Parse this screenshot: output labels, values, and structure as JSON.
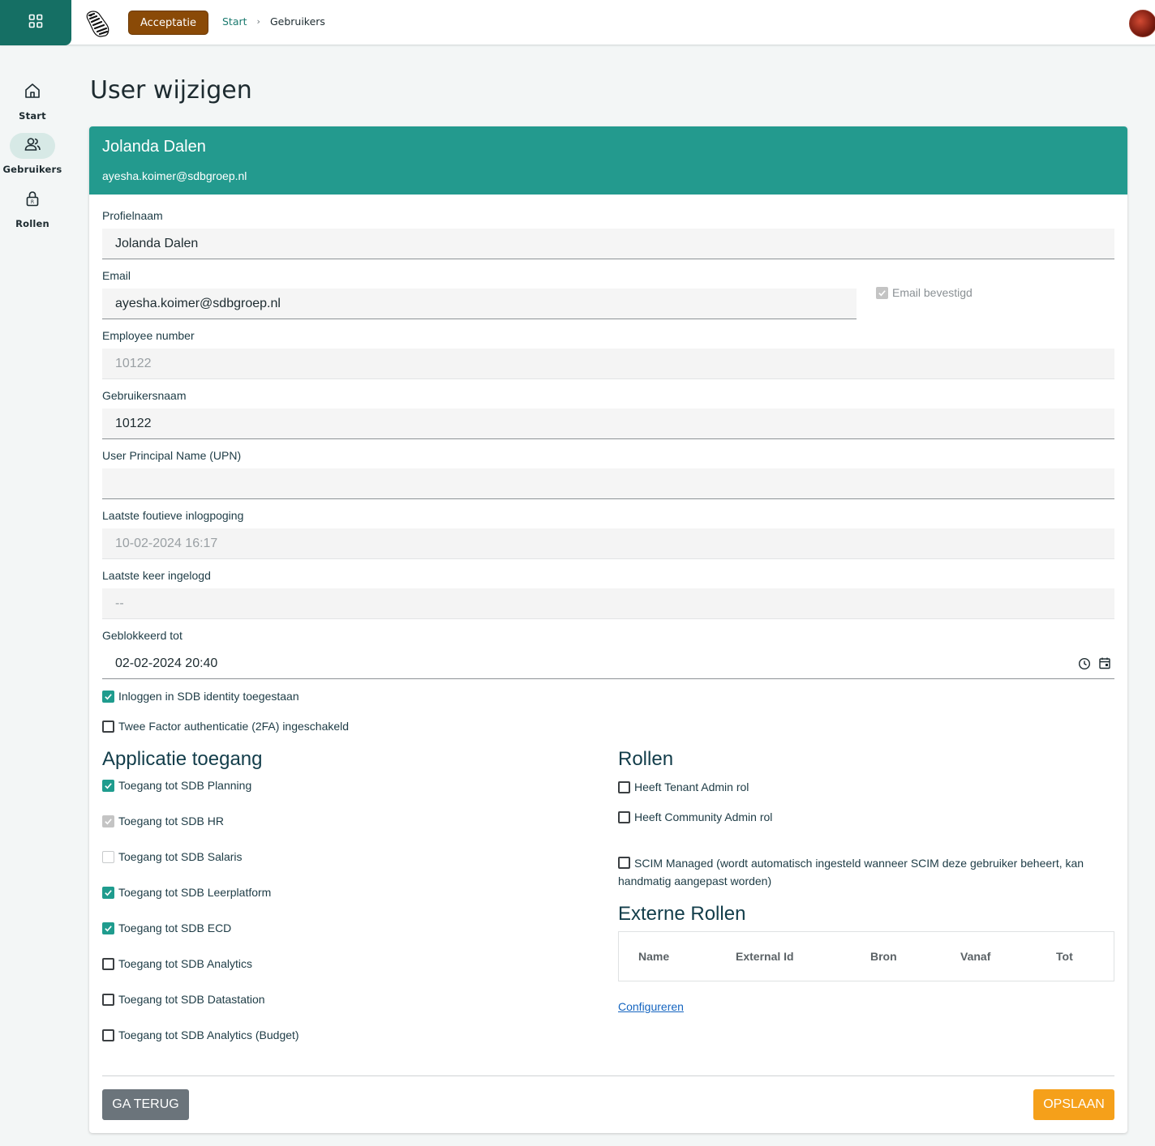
{
  "topbar": {
    "env_badge": "Acceptatie",
    "breadcrumb": {
      "start": "Start",
      "current": "Gebruikers"
    }
  },
  "sidenav": {
    "items": [
      {
        "label": "Start",
        "icon": "home-icon",
        "active": false
      },
      {
        "label": "Gebruikers",
        "icon": "users-icon",
        "active": true
      },
      {
        "label": "Rollen",
        "icon": "lock-icon",
        "active": false
      }
    ]
  },
  "page": {
    "title": "User wijzigen"
  },
  "card_header": {
    "name": "Jolanda Dalen",
    "email": "ayesha.koimer@sdbgroep.nl"
  },
  "form": {
    "profielnaam": {
      "label": "Profielnaam",
      "value": "Jolanda Dalen"
    },
    "email": {
      "label": "Email",
      "value": "ayesha.koimer@sdbgroep.nl",
      "confirmed_label": "Email bevestigd",
      "confirmed": true
    },
    "employee_number": {
      "label": "Employee number",
      "value": "10122"
    },
    "gebruikersnaam": {
      "label": "Gebruikersnaam",
      "value": "10122"
    },
    "upn": {
      "label": "User Principal Name (UPN)",
      "value": ""
    },
    "laatste_foutieve": {
      "label": "Laatste foutieve inlogpoging",
      "value": "10-02-2024 16:17"
    },
    "laatste_ingelogd": {
      "label": "Laatste keer ingelogd",
      "value": "--"
    },
    "geblokkeerd_tot": {
      "label": "Geblokkeerd tot",
      "value": "02-02-2024 20:40"
    },
    "inloggen": {
      "label": "Inloggen in SDB identity toegestaan",
      "checked": true
    },
    "twee_factor": {
      "label": "Twee Factor authenticatie (2FA) ingeschakeld",
      "checked": false
    }
  },
  "applicatie_toegang": {
    "title": "Applicatie toegang",
    "items": [
      {
        "label": "Toegang tot SDB Planning",
        "state": "checked"
      },
      {
        "label": "Toegang tot SDB HR",
        "state": "disabled-checked"
      },
      {
        "label": "Toegang tot SDB Salaris",
        "state": "disabled"
      },
      {
        "label": "Toegang tot SDB Leerplatform",
        "state": "checked"
      },
      {
        "label": "Toegang tot SDB ECD",
        "state": "checked"
      },
      {
        "label": "Toegang tot SDB Analytics",
        "state": "unchecked"
      },
      {
        "label": "Toegang tot SDB Datastation",
        "state": "unchecked"
      },
      {
        "label": "Toegang tot SDB Analytics (Budget)",
        "state": "unchecked"
      }
    ]
  },
  "rollen": {
    "title": "Rollen",
    "tenant_admin": "Heeft Tenant Admin rol",
    "community_admin": "Heeft Community Admin rol",
    "scim_managed": "SCIM Managed (wordt automatisch ingesteld wanneer SCIM deze gebruiker beheert, kan handmatig aangepast worden)"
  },
  "externe_rollen": {
    "title": "Externe Rollen",
    "columns": [
      "Name",
      "External Id",
      "Bron",
      "Vanaf",
      "Tot"
    ],
    "configure_link": "Configureren"
  },
  "actions": {
    "back": "GA TERUG",
    "save": "OPSLAAN"
  },
  "colors": {
    "primary": "#156f64",
    "header": "#239a8e",
    "env": "#8a4a07",
    "save": "#f5a01a",
    "back": "#6b747b"
  }
}
